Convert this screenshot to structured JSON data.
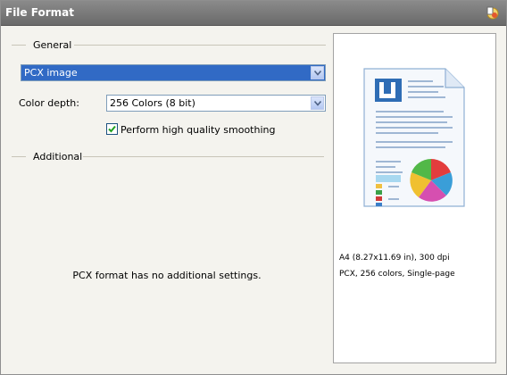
{
  "window": {
    "title": "File Format",
    "title_icon": "settings-wand-icon"
  },
  "general": {
    "label": "General",
    "format_select": {
      "value": "PCX image"
    },
    "color_depth": {
      "label": "Color depth:",
      "value": "256 Colors (8 bit)"
    },
    "smoothing": {
      "label": "Perform high quality smoothing",
      "checked": true
    }
  },
  "additional": {
    "label": "Additional",
    "message": "PCX format has no additional settings."
  },
  "preview": {
    "line1": "A4 (8.27x11.69 in), 300 dpi",
    "line2": "PCX, 256 colors, Single-page"
  },
  "colors": {
    "selection": "#316ac5",
    "titlebar": "#7a7a7a"
  }
}
